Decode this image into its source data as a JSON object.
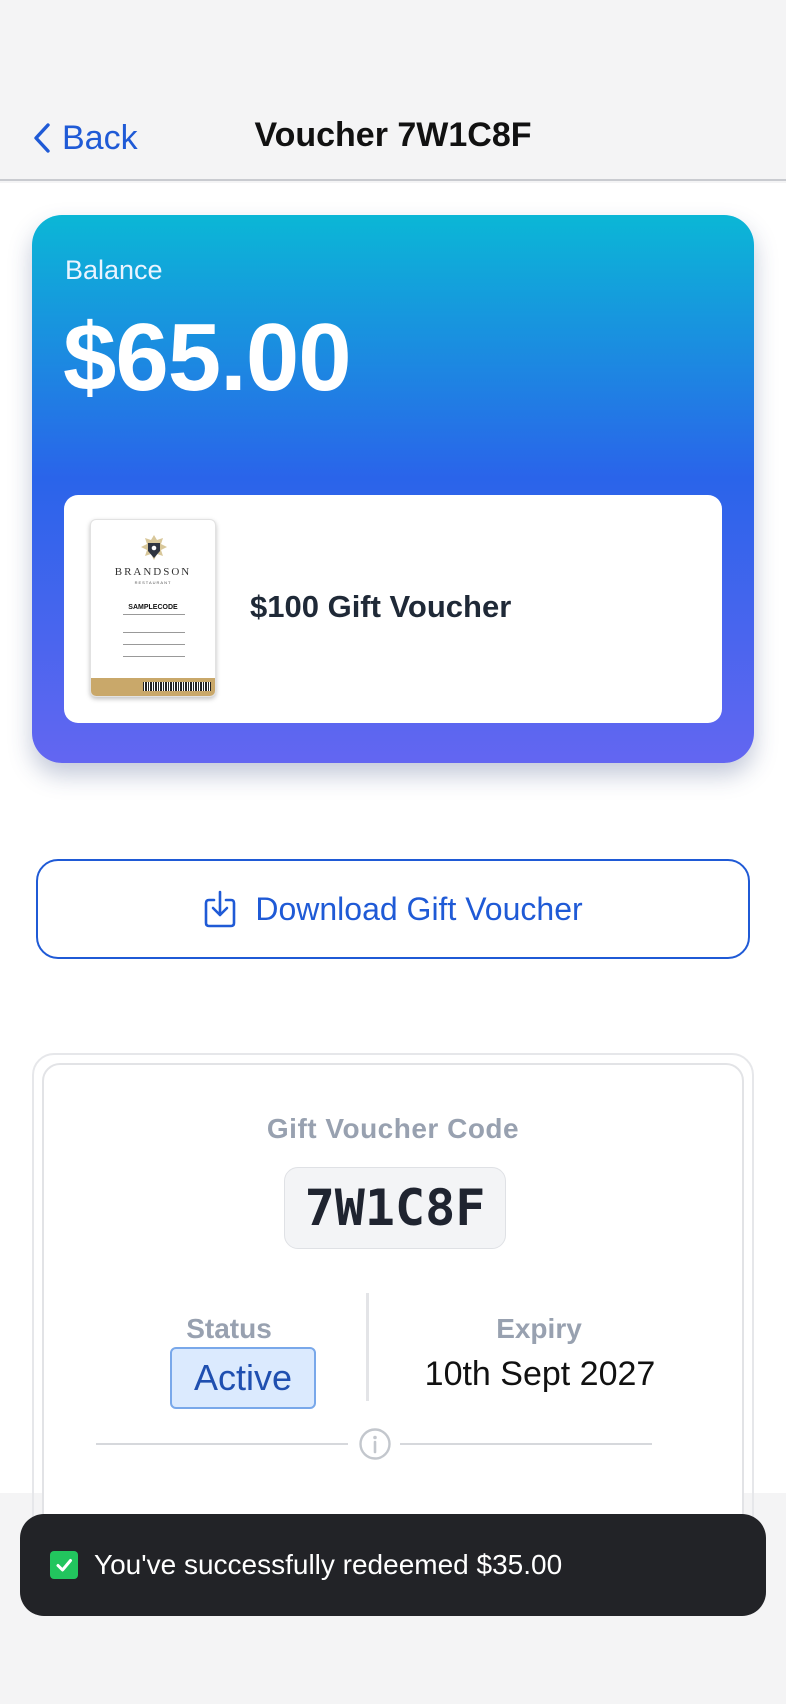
{
  "nav": {
    "back_label": "Back",
    "title": "Voucher 7W1C8F"
  },
  "balance": {
    "label": "Balance",
    "amount": "$65.00"
  },
  "product": {
    "title": "$100 Gift Voucher",
    "thumbnail": {
      "brand": "BRANDSON",
      "brand_sub": "RESTAURANT",
      "code": "SAMPLECODE"
    }
  },
  "download": {
    "label": "Download Gift Voucher"
  },
  "voucher": {
    "code_label": "Gift Voucher Code",
    "code": "7W1C8F",
    "status_label": "Status",
    "status": "Active",
    "expiry_label": "Expiry",
    "expiry": "10th Sept 2027"
  },
  "toast": {
    "message": "You've successfully redeemed $35.00"
  },
  "colors": {
    "accent": "#1f5ad6",
    "card_gradient_top": "#0bb7d6",
    "card_gradient_bottom": "#6366f1",
    "toast_bg": "#222327",
    "success": "#22c55e"
  }
}
